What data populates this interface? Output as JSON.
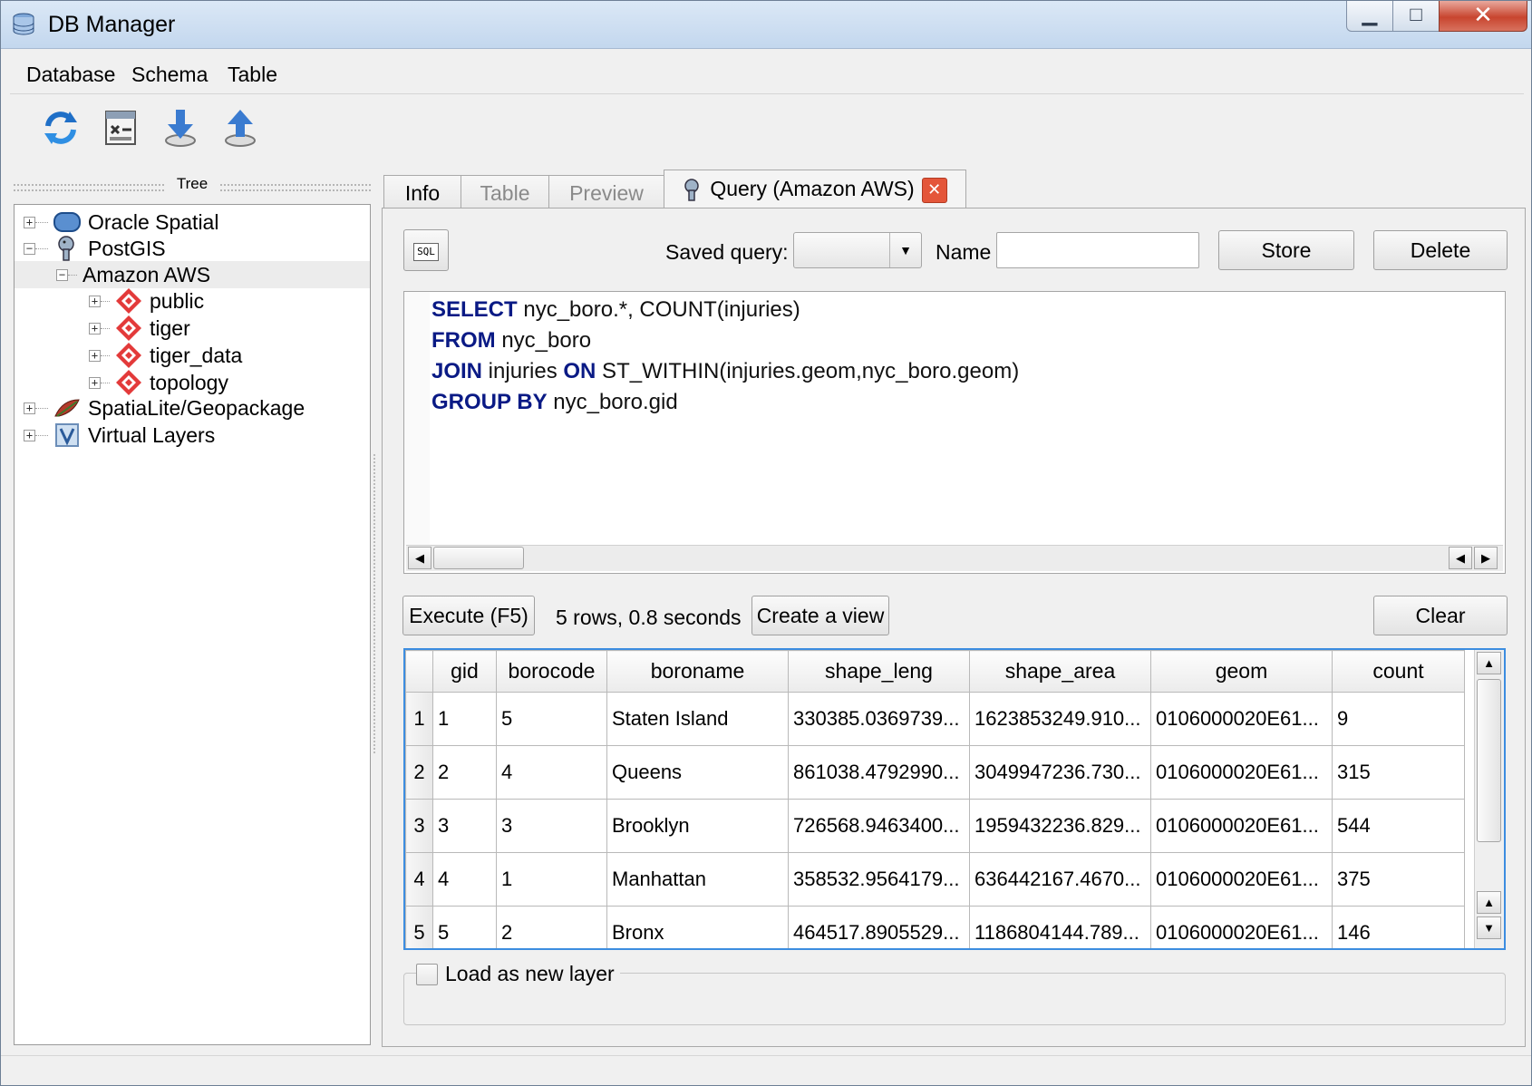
{
  "window": {
    "title": "DB Manager"
  },
  "menu": [
    "Database",
    "Schema",
    "Table"
  ],
  "toolbar": {
    "icons": [
      "refresh-icon",
      "sql-window-icon",
      "import-layer-icon",
      "export-layer-icon"
    ]
  },
  "tree": {
    "header": "Tree",
    "items": [
      {
        "label": "Oracle Spatial",
        "icon": "oracle-spatial-icon",
        "expander": "+"
      },
      {
        "label": "PostGIS",
        "icon": "postgis-elephant-icon",
        "expander": "−"
      },
      {
        "label": "Amazon AWS",
        "icon": "",
        "expander": "−"
      },
      {
        "label": "public",
        "icon": "schema-icon",
        "expander": "+"
      },
      {
        "label": "tiger",
        "icon": "schema-icon",
        "expander": "+"
      },
      {
        "label": "tiger_data",
        "icon": "schema-icon",
        "expander": "+"
      },
      {
        "label": "topology",
        "icon": "schema-icon",
        "expander": "+"
      },
      {
        "label": "SpatiaLite/Geopackage",
        "icon": "spatialite-feather-icon",
        "expander": "+"
      },
      {
        "label": "Virtual Layers",
        "icon": "virtual-layer-icon",
        "expander": "+"
      }
    ]
  },
  "tabs": {
    "info": "Info",
    "table": "Table",
    "preview": "Preview",
    "query": "Query (Amazon AWS)",
    "close_glyph": "✕"
  },
  "query": {
    "sql_icon_label": "SQL",
    "saved_query_label": "Saved query:",
    "saved_query_value": "",
    "name_label": "Name",
    "name_value": "",
    "store_label": "Store",
    "delete_label": "Delete",
    "sql_lines": [
      {
        "kw1": "SELECT",
        "rest1": " nyc_boro.*, COUNT(injuries)"
      },
      {
        "kw1": "FROM",
        "rest1": " nyc_boro"
      },
      {
        "kw1": "JOIN",
        "rest1": " injuries ",
        "kw2": "ON",
        "rest2": " ST_WITHIN(injuries.geom,nyc_boro.geom)"
      },
      {
        "kw1": "GROUP BY",
        "rest1": " nyc_boro.gid"
      }
    ],
    "execute_label": "Execute (F5)",
    "status": "5 rows, 0.8 seconds",
    "create_view_label": "Create a view",
    "clear_label": "Clear",
    "load_as_layer_label": "Load as new layer"
  },
  "results": {
    "columns": [
      "gid",
      "borocode",
      "boroname",
      "shape_leng",
      "shape_area",
      "geom",
      "count"
    ],
    "rows": [
      [
        "1",
        "1",
        "5",
        "Staten Island",
        "330385.0369739...",
        "1623853249.910...",
        "0106000020E61...",
        "9"
      ],
      [
        "2",
        "2",
        "4",
        "Queens",
        "861038.4792990...",
        "3049947236.730...",
        "0106000020E61...",
        "315"
      ],
      [
        "3",
        "3",
        "3",
        "Brooklyn",
        "726568.9463400...",
        "1959432236.829...",
        "0106000020E61...",
        "544"
      ],
      [
        "4",
        "4",
        "1",
        "Manhattan",
        "358532.9564179...",
        "636442167.4670...",
        "0106000020E61...",
        "375"
      ],
      [
        "5",
        "5",
        "2",
        "Bronx",
        "464517.8905529...",
        "1186804144.789...",
        "0106000020E61...",
        "146"
      ]
    ]
  },
  "colors": {
    "keyword": "#0a1a85",
    "focus_border": "#3c8de0",
    "close_red": "#e4563a"
  }
}
